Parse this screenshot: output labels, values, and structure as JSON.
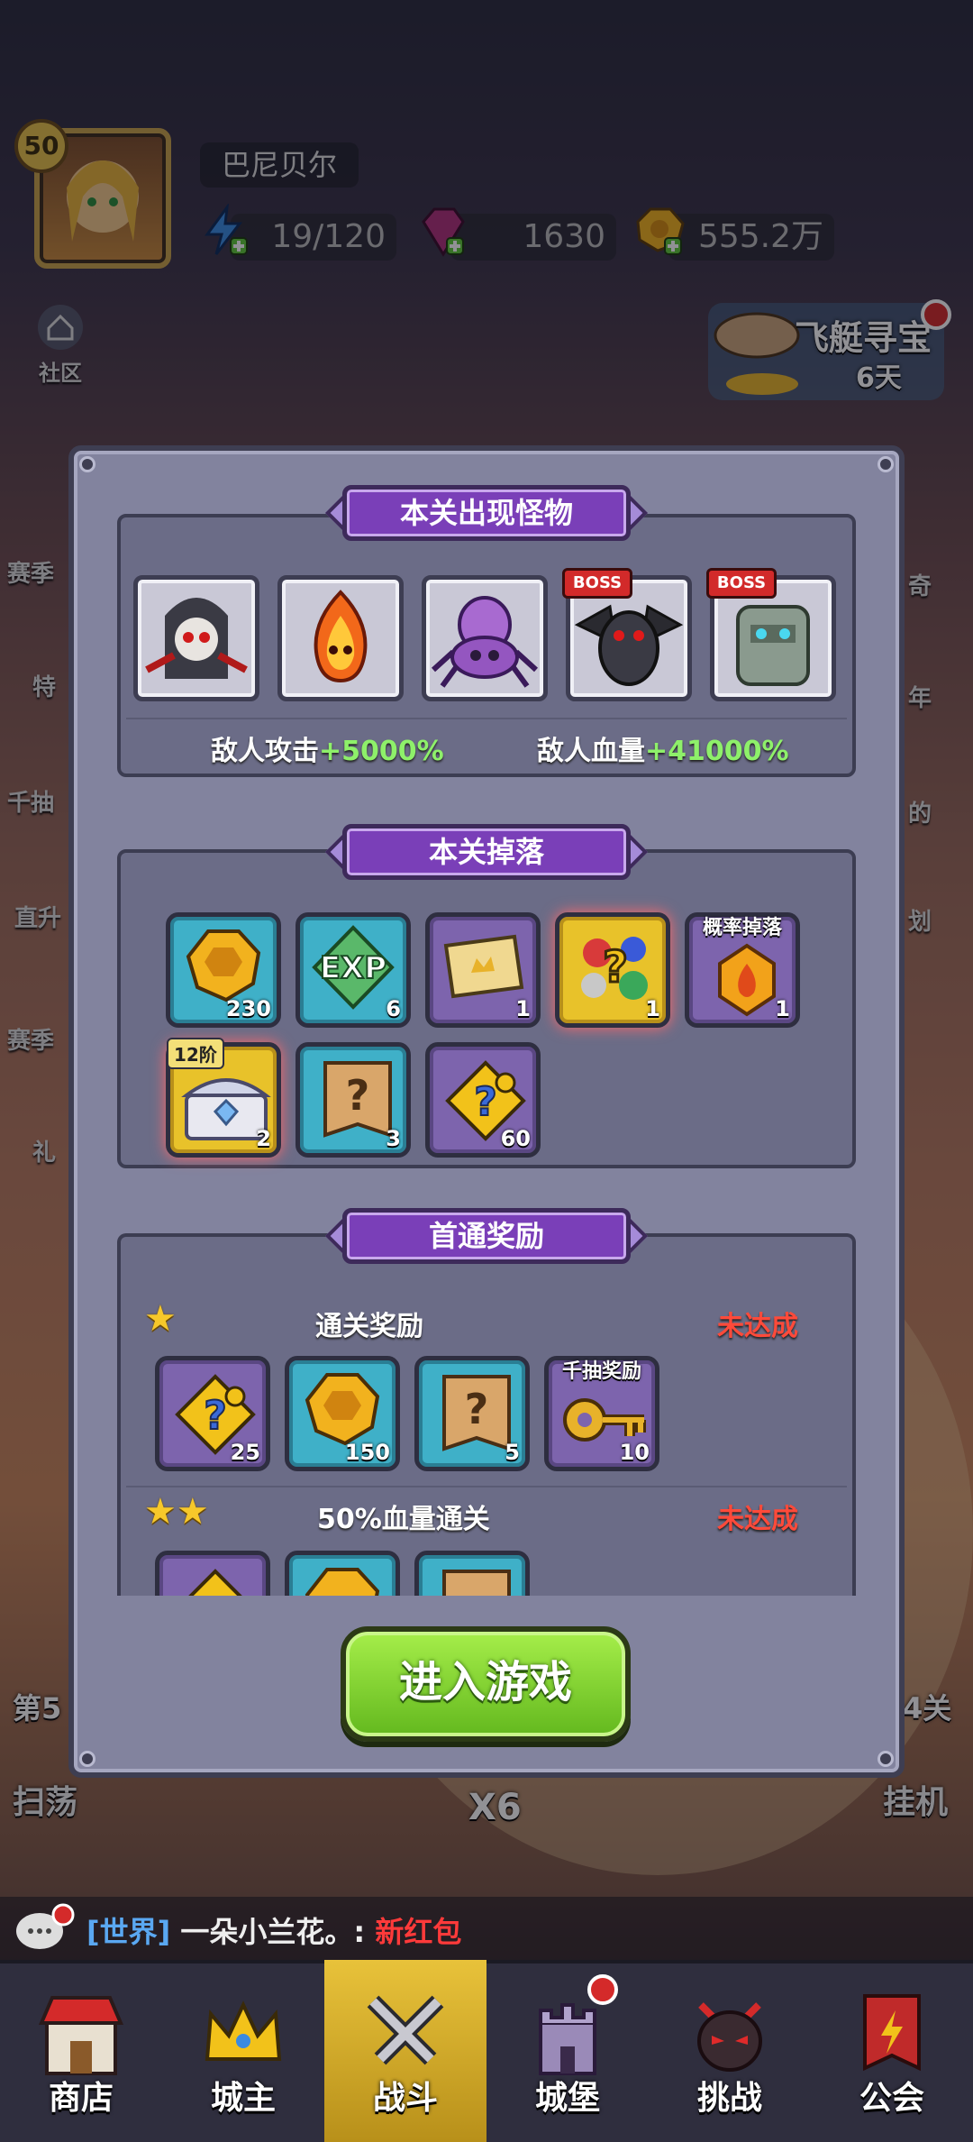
{
  "header": {
    "level": "50",
    "player_name": "巴尼贝尔",
    "energy": "19/120",
    "gems": "1630",
    "gold": "555.2万"
  },
  "community_label": "社区",
  "airship": {
    "title": "飞艇寻宝",
    "days": "6天"
  },
  "side_left": [
    "赛季",
    "特",
    "千抽",
    "直升",
    "赛季",
    "礼"
  ],
  "side_right": [
    "奇",
    "年",
    "的",
    "划"
  ],
  "background_labels": {
    "stage_left": "第5",
    "stage_right": "4关",
    "sweep": "扫荡",
    "multiplier": "X6",
    "idle": "挂机"
  },
  "monsters_section": {
    "title": "本关出现怪物",
    "monsters": [
      {
        "name": "skeleton-reaper",
        "boss": ""
      },
      {
        "name": "fire-spirit",
        "boss": ""
      },
      {
        "name": "purple-spider",
        "boss": ""
      },
      {
        "name": "dark-gargoyle",
        "boss": "BOSS"
      },
      {
        "name": "stone-golem",
        "boss": "BOSS"
      }
    ],
    "enemy_attack_label": "敌人攻击",
    "enemy_attack_value": "+5000%",
    "enemy_hp_label": "敌人血量",
    "enemy_hp_value": "+41000%"
  },
  "drops_section": {
    "title": "本关掉落",
    "items": [
      {
        "icon": "gold-coin-icon",
        "count": "230",
        "style": "teal",
        "tag": ""
      },
      {
        "icon": "exp-icon",
        "count": "6",
        "style": "teal",
        "tag": ""
      },
      {
        "icon": "ticket-icon",
        "count": "1",
        "style": "purple",
        "tag": ""
      },
      {
        "icon": "random-gem-bag-icon",
        "count": "1",
        "style": "gold",
        "tag": ""
      },
      {
        "icon": "flame-crystal-icon",
        "count": "1",
        "style": "purple",
        "tag": "概率掉落"
      },
      {
        "icon": "treasure-chest-icon",
        "count": "2",
        "style": "gold",
        "tag": "12阶"
      },
      {
        "icon": "mystery-scroll-icon",
        "count": "3",
        "style": "teal",
        "tag": ""
      },
      {
        "icon": "mystery-puzzle-icon",
        "count": "60",
        "style": "purple",
        "tag": ""
      }
    ]
  },
  "first_clear_section": {
    "title": "首通奖励",
    "tiers": [
      {
        "stars": 1,
        "label": "通关奖励",
        "status": "未达成",
        "rewards": [
          {
            "icon": "mystery-puzzle-icon",
            "count": "25",
            "style": "purple",
            "tag": ""
          },
          {
            "icon": "gold-coin-icon",
            "count": "150",
            "style": "teal",
            "tag": ""
          },
          {
            "icon": "mystery-scroll-icon",
            "count": "5",
            "style": "teal",
            "tag": ""
          },
          {
            "icon": "key-icon",
            "count": "10",
            "style": "purple",
            "tag": "千抽奖励"
          }
        ]
      },
      {
        "stars": 2,
        "label": "50%血量通关",
        "status": "未达成",
        "rewards": [
          {
            "icon": "mystery-puzzle-icon",
            "count": "",
            "style": "purple",
            "tag": ""
          },
          {
            "icon": "gold-coin-icon",
            "count": "",
            "style": "teal",
            "tag": ""
          },
          {
            "icon": "mystery-scroll-icon",
            "count": "",
            "style": "teal",
            "tag": ""
          }
        ]
      }
    ]
  },
  "enter_button": "进入游戏",
  "chat": {
    "channel": "[世界]",
    "user": "一朵小兰花。:",
    "message": "新红包"
  },
  "nav": [
    {
      "label": "商店",
      "icon": "shop-icon"
    },
    {
      "label": "城主",
      "icon": "crown-icon"
    },
    {
      "label": "战斗",
      "icon": "crossed-swords-icon",
      "active": true
    },
    {
      "label": "城堡",
      "icon": "castle-icon"
    },
    {
      "label": "挑战",
      "icon": "demon-mask-icon"
    },
    {
      "label": "公会",
      "icon": "guild-banner-icon"
    }
  ],
  "colors": {
    "accent_green": "#8ef06a",
    "warning_red": "#ff4a3a",
    "banner_purple": "#7a3fb8",
    "nav_active": "#d9b52a"
  }
}
